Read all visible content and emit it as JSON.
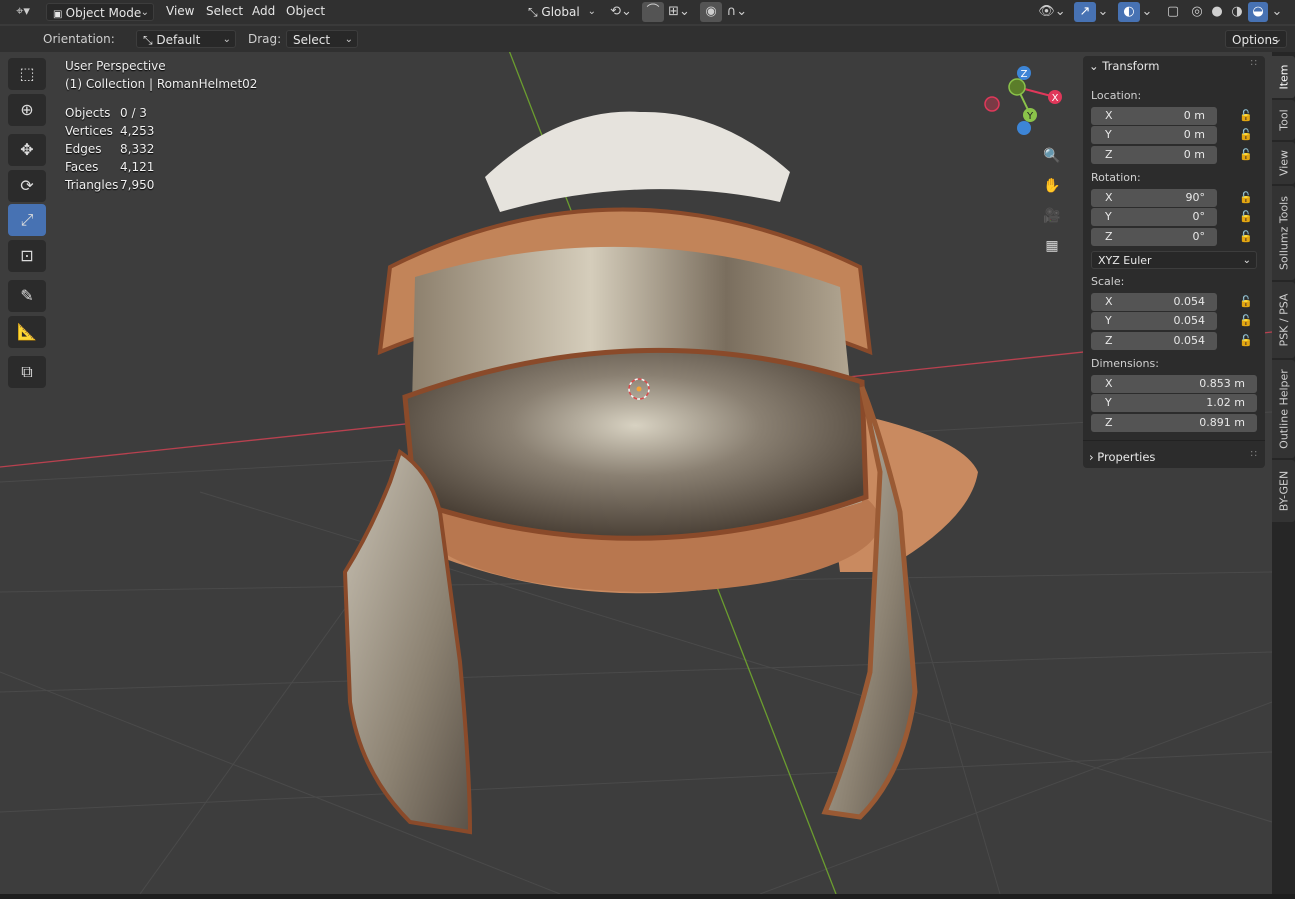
{
  "header": {
    "mode": "Object Mode",
    "menus": [
      "View",
      "Select",
      "Add",
      "Object"
    ],
    "transform_orientation": "Global"
  },
  "tool_settings": {
    "orientation_label": "Orientation:",
    "orientation_value": "Default",
    "drag_label": "Drag:",
    "drag_value": "Select Box",
    "options_label": "Options"
  },
  "viewport": {
    "view_name": "User Perspective",
    "collection": "(1) Collection | RomanHelmet02",
    "stats": [
      {
        "label": "Objects",
        "value": "0 / 3"
      },
      {
        "label": "Vertices",
        "value": "4,253"
      },
      {
        "label": "Edges",
        "value": "8,332"
      },
      {
        "label": "Faces",
        "value": "4,121"
      },
      {
        "label": "Triangles",
        "value": "7,950"
      }
    ],
    "gizmo_axes": [
      "Z",
      "X",
      "Y"
    ]
  },
  "n_panel": {
    "transform_title": "Transform",
    "location_label": "Location:",
    "location": [
      {
        "axis": "X",
        "value": "0 m"
      },
      {
        "axis": "Y",
        "value": "0 m"
      },
      {
        "axis": "Z",
        "value": "0 m"
      }
    ],
    "rotation_label": "Rotation:",
    "rotation": [
      {
        "axis": "X",
        "value": "90°"
      },
      {
        "axis": "Y",
        "value": "0°"
      },
      {
        "axis": "Z",
        "value": "0°"
      }
    ],
    "rotation_mode": "XYZ Euler",
    "scale_label": "Scale:",
    "scale": [
      {
        "axis": "X",
        "value": "0.054"
      },
      {
        "axis": "Y",
        "value": "0.054"
      },
      {
        "axis": "Z",
        "value": "0.054"
      }
    ],
    "dimensions_label": "Dimensions:",
    "dimensions": [
      {
        "axis": "X",
        "value": "0.853 m"
      },
      {
        "axis": "Y",
        "value": "1.02 m"
      },
      {
        "axis": "Z",
        "value": "0.891 m"
      }
    ],
    "properties_title": "Properties"
  },
  "side_tabs": [
    "Item",
    "Tool",
    "View",
    "Sollumz Tools",
    "PSK / PSA",
    "Outline Helper",
    "BY-GEN"
  ],
  "colors": {
    "accent": "#4772b3",
    "x_axis": "#e0385a",
    "y_axis": "#8bc34a",
    "z_axis": "#3d85d6"
  }
}
